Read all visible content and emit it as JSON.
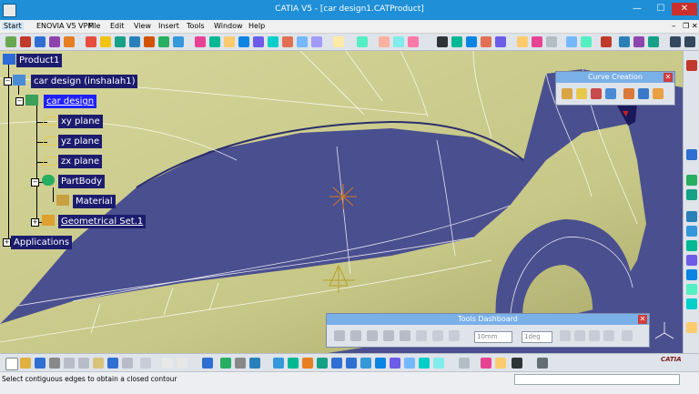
{
  "window": {
    "title": "CATIA V5 - [car design1.CATProduct]",
    "minimize": "—",
    "maximize": "☐",
    "close": "✕"
  },
  "menu": [
    "Start",
    "ENOVIA V5 VPM",
    "File",
    "Edit",
    "View",
    "Insert",
    "Tools",
    "Window",
    "Help"
  ],
  "tree": {
    "root": "Product1",
    "part_instance": "car design (inshalah1)",
    "part": "car design",
    "planes": [
      "xy plane",
      "yz plane",
      "zx plane"
    ],
    "body": "PartBody",
    "material": "Material",
    "geoset": "Geometrical Set.1",
    "applications": "Applications"
  },
  "curve_creation": {
    "title": "Curve Creation",
    "close": "✕"
  },
  "tools_dashboard": {
    "title": "Tools Dashboard",
    "close": "✕",
    "length_value": "10mm",
    "angle_value": "1deg"
  },
  "status": {
    "message": "Select contiguous edges to obtain a closed contour"
  },
  "logo": "CATIA",
  "axis": {
    "x": "x",
    "y": "y",
    "z": "z"
  },
  "colors": {
    "titlebar": "#1f8fd7",
    "viewport_bg": "#4a4f8f",
    "surface": "#c9c98a",
    "selection": "#2020ff"
  }
}
